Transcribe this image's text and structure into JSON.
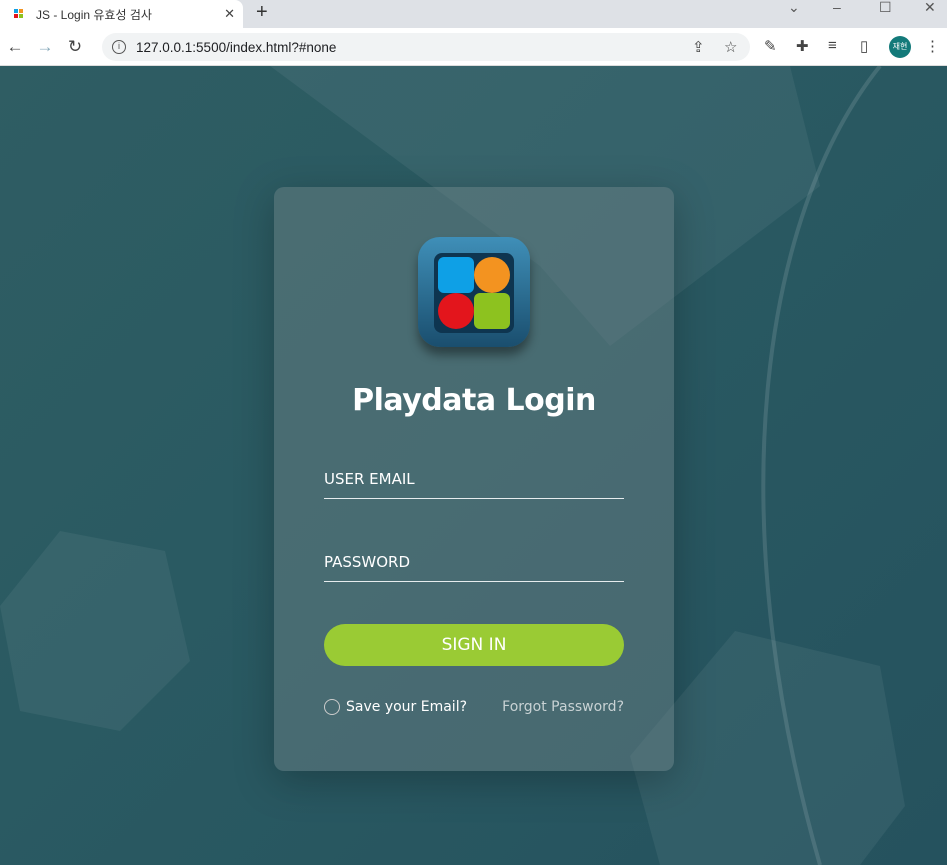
{
  "browser": {
    "tab_title": "JS - Login 유효성 검사",
    "tab_close": "✕",
    "new_tab": "+",
    "url": "127.0.0.1:5500/index.html?#none",
    "profile_initials": "재현"
  },
  "login": {
    "title": "Playdata Login",
    "email_placeholder": "USER EMAIL",
    "password_placeholder": "PASSWORD",
    "sign_in_label": "SIGN IN",
    "save_email_label": "Save your Email?",
    "forgot_password_label": "Forgot Password?"
  },
  "colors": {
    "accent": "#9acb34",
    "logo_blue": "#0ea0e6",
    "logo_orange": "#f39320",
    "logo_red": "#e3151c",
    "logo_green": "#8dc21f"
  }
}
